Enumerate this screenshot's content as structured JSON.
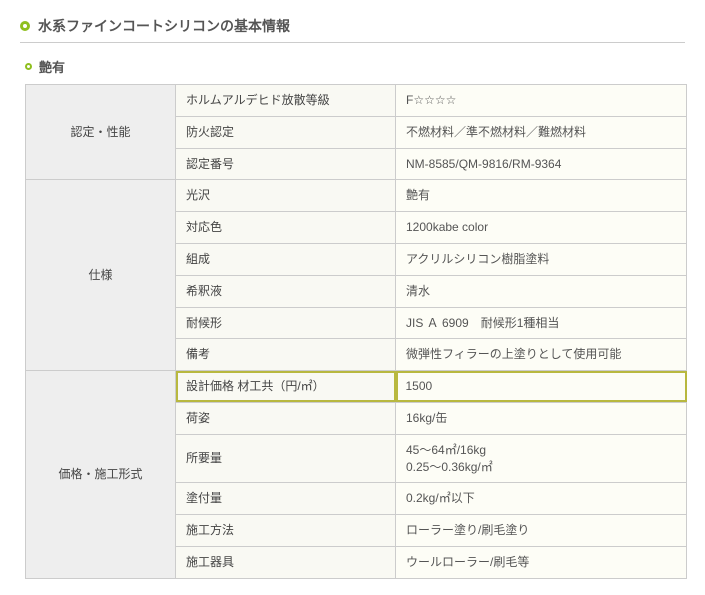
{
  "main_title": "水系ファインコートシリコンの基本情報",
  "sub_title": "艶有",
  "groups": [
    {
      "category": "認定・性能",
      "rows": [
        {
          "label": "ホルムアルデヒド放散等級",
          "value": "F☆☆☆☆"
        },
        {
          "label": "防火認定",
          "value": "不燃材料／準不燃材料／難燃材料"
        },
        {
          "label": "認定番号",
          "value": "NM-8585/QM-9816/RM-9364"
        }
      ]
    },
    {
      "category": "仕様",
      "rows": [
        {
          "label": "光沢",
          "value": "艶有"
        },
        {
          "label": "対応色",
          "value": "1200kabe color"
        },
        {
          "label": "組成",
          "value": "アクリルシリコン樹脂塗料"
        },
        {
          "label": "希釈液",
          "value": "清水"
        },
        {
          "label": "耐候形",
          "value": "JIS Ａ 6909　耐候形1種相当"
        },
        {
          "label": "備考",
          "value": "微弾性フィラーの上塗りとして使用可能"
        }
      ]
    },
    {
      "category": "価格・施工形式",
      "rows": [
        {
          "label": "設計価格  材工共（円/㎡）",
          "value": "1500",
          "highlight": true
        },
        {
          "label": "荷姿",
          "value": "16kg/缶"
        },
        {
          "label": "所要量",
          "value": "45～64㎡/16kg\n0.25～0.36kg/㎡"
        },
        {
          "label": "塗付量",
          "value": "0.2kg/㎡以下"
        },
        {
          "label": "施工方法",
          "value": "ローラー塗り/刷毛塗り"
        },
        {
          "label": "施工器具",
          "value": "ウールローラー/刷毛等"
        }
      ]
    }
  ]
}
